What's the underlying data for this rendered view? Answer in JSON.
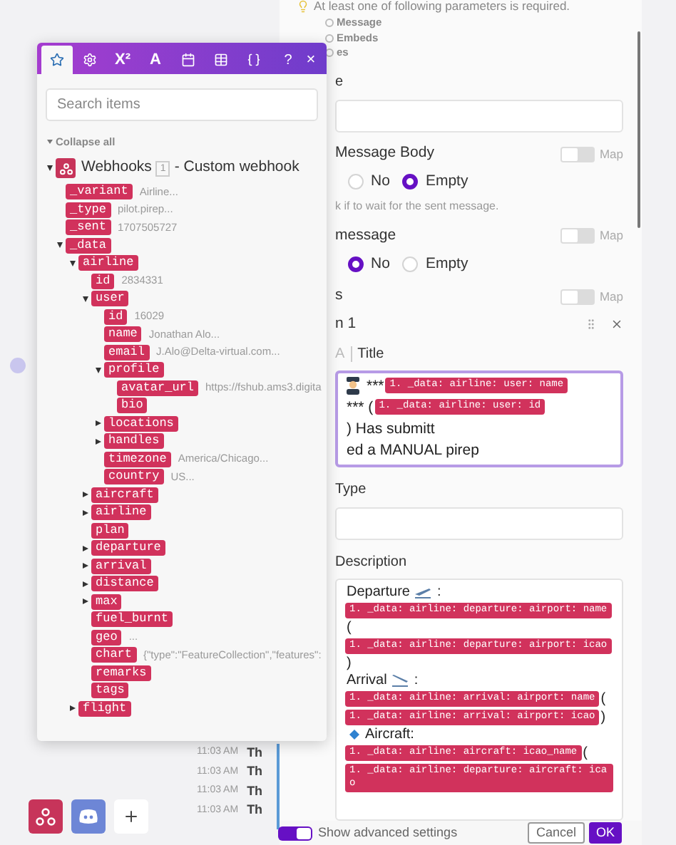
{
  "settings_panel": {
    "hint": {
      "text": "At least one of following parameters is required.",
      "options": [
        {
          "label": "Message"
        },
        {
          "label": "Embeds"
        },
        {
          "label": "es"
        }
      ]
    },
    "sections": [
      {
        "kind": "input",
        "label": "e"
      },
      {
        "kind": "radio",
        "label": "Message Body",
        "map": {
          "label": "Map",
          "on": false
        },
        "options": [
          {
            "label": "No",
            "selected": false
          },
          {
            "label": "Empty",
            "selected": true
          }
        ],
        "help": "k if to wait for the sent message."
      },
      {
        "kind": "radio",
        "label": "message",
        "map": {
          "label": "Map",
          "on": false
        },
        "options": [
          {
            "label": "No",
            "selected": true
          },
          {
            "label": "Empty",
            "selected": false
          }
        ]
      },
      {
        "kind": "heading",
        "label": "s",
        "map": {
          "label": "Map",
          "on": false
        }
      },
      {
        "kind": "item",
        "label": "n 1"
      },
      {
        "kind": "rich",
        "prefix": "A",
        "label": "Title",
        "focused": true,
        "segments": [
          {
            "kind": "pilot"
          },
          {
            "kind": "text",
            "text": "***"
          },
          {
            "kind": "pill",
            "text": "1. _data: airline: user: name"
          },
          {
            "kind": "text",
            "text": "*** ("
          },
          {
            "kind": "pill",
            "text": "1. _data: airline: user: id"
          },
          {
            "kind": "text",
            "text": ") Has submitt"
          },
          {
            "kind": "break"
          },
          {
            "kind": "text",
            "text": "ed a MANUAL pirep"
          }
        ]
      },
      {
        "kind": "input",
        "label": "Type"
      },
      {
        "kind": "rich",
        "label": "Description",
        "focused": false,
        "segments": [
          {
            "kind": "text",
            "text": "Departure"
          },
          {
            "kind": "takeoff"
          },
          {
            "kind": "text",
            "text": ":"
          },
          {
            "kind": "break"
          },
          {
            "kind": "pill",
            "text": "1. _data: airline: departure: airport: name"
          },
          {
            "kind": "break"
          },
          {
            "kind": "text",
            "text": "("
          },
          {
            "kind": "break"
          },
          {
            "kind": "pill",
            "text": "1. _data: airline: departure: airport: icao"
          },
          {
            "kind": "break"
          },
          {
            "kind": "text",
            "text": ")"
          },
          {
            "kind": "break"
          },
          {
            "kind": "text",
            "text": "Arrival"
          },
          {
            "kind": "landing"
          },
          {
            "kind": "text",
            "text": ":"
          },
          {
            "kind": "break"
          },
          {
            "kind": "pill",
            "text": "1. _data: airline: arrival: airport: name"
          },
          {
            "kind": "text",
            "text": "("
          },
          {
            "kind": "break"
          },
          {
            "kind": "pill",
            "text": "1. _data: airline: arrival: airport: icao"
          },
          {
            "kind": "text",
            "text": ")"
          },
          {
            "kind": "break"
          },
          {
            "kind": "diamond"
          },
          {
            "kind": "text",
            "text": "Aircraft:"
          },
          {
            "kind": "break"
          },
          {
            "kind": "pill",
            "text": "1. _data: airline: aircraft: icao_name"
          },
          {
            "kind": "text",
            "text": "("
          },
          {
            "kind": "break"
          },
          {
            "kind": "pill",
            "text": "1. _data: airline: departure: aircraft: icao"
          }
        ]
      }
    ],
    "footer": {
      "advanced": {
        "label": "Show advanced settings",
        "on": true
      },
      "buttons": [
        {
          "label": "Cancel",
          "kind": "secondary"
        },
        {
          "label": "OK",
          "kind": "primary"
        }
      ]
    }
  },
  "log": [
    {
      "time": "11:03 AM",
      "text": "Th"
    },
    {
      "time": "11:03 AM",
      "text": "Th"
    },
    {
      "time": "11:03 AM",
      "text": "Th"
    },
    {
      "time": "11:03 AM",
      "text": "Th"
    }
  ],
  "apps": [
    {
      "kind": "webhook"
    },
    {
      "kind": "discord"
    },
    {
      "kind": "add"
    }
  ],
  "mapper": {
    "tabs": [
      {
        "kind": "favorites",
        "selected": true
      },
      {
        "kind": "general",
        "selected": false
      },
      {
        "kind": "math",
        "label": "X²",
        "selected": false
      },
      {
        "kind": "text",
        "label": "A",
        "selected": false
      },
      {
        "kind": "date",
        "selected": false
      },
      {
        "kind": "array",
        "selected": false
      },
      {
        "kind": "json",
        "selected": false
      }
    ],
    "help": "?",
    "close": "×",
    "search": {
      "placeholder": "Search items"
    },
    "collapse_label": "Collapse all",
    "module": {
      "name": "Webhooks",
      "count": "1",
      "suffix": "- Custom webhook",
      "expanded": true,
      "children": [
        {
          "key": "_variant",
          "value": "Airline..."
        },
        {
          "key": "_type",
          "value": "pilot.pirep..."
        },
        {
          "key": "_sent",
          "value": "1707505727"
        },
        {
          "key": "_data",
          "expanded": true,
          "children": [
            {
              "key": "airline",
              "expanded": true,
              "children": [
                {
                  "key": "id",
                  "value": "2834331"
                },
                {
                  "key": "user",
                  "expanded": true,
                  "children": [
                    {
                      "key": "id",
                      "value": "16029"
                    },
                    {
                      "key": "name",
                      "value": "Jonathan Alo..."
                    },
                    {
                      "key": "email",
                      "value": "J.Alo@Delta-virtual.com..."
                    },
                    {
                      "key": "profile",
                      "expanded": true,
                      "children": [
                        {
                          "key": "avatar_url",
                          "value": "https://fshub.ams3.digita"
                        },
                        {
                          "key": "bio"
                        }
                      ]
                    },
                    {
                      "key": "locations",
                      "expanded": false
                    },
                    {
                      "key": "handles",
                      "expanded": false
                    },
                    {
                      "key": "timezone",
                      "value": "America/Chicago..."
                    },
                    {
                      "key": "country",
                      "value": "US..."
                    }
                  ]
                },
                {
                  "key": "aircraft",
                  "expanded": false
                },
                {
                  "key": "airline",
                  "expanded": false
                },
                {
                  "key": "plan"
                },
                {
                  "key": "departure",
                  "expanded": false
                },
                {
                  "key": "arrival",
                  "expanded": false
                },
                {
                  "key": "distance",
                  "expanded": false
                },
                {
                  "key": "max",
                  "expanded": false
                },
                {
                  "key": "fuel_burnt"
                },
                {
                  "key": "geo",
                  "value": "..."
                },
                {
                  "key": "chart",
                  "value": "{\"type\":\"FeatureCollection\",\"features\":"
                },
                {
                  "key": "remarks"
                },
                {
                  "key": "tags"
                }
              ]
            },
            {
              "key": "flight",
              "expanded": false
            }
          ]
        }
      ]
    }
  }
}
